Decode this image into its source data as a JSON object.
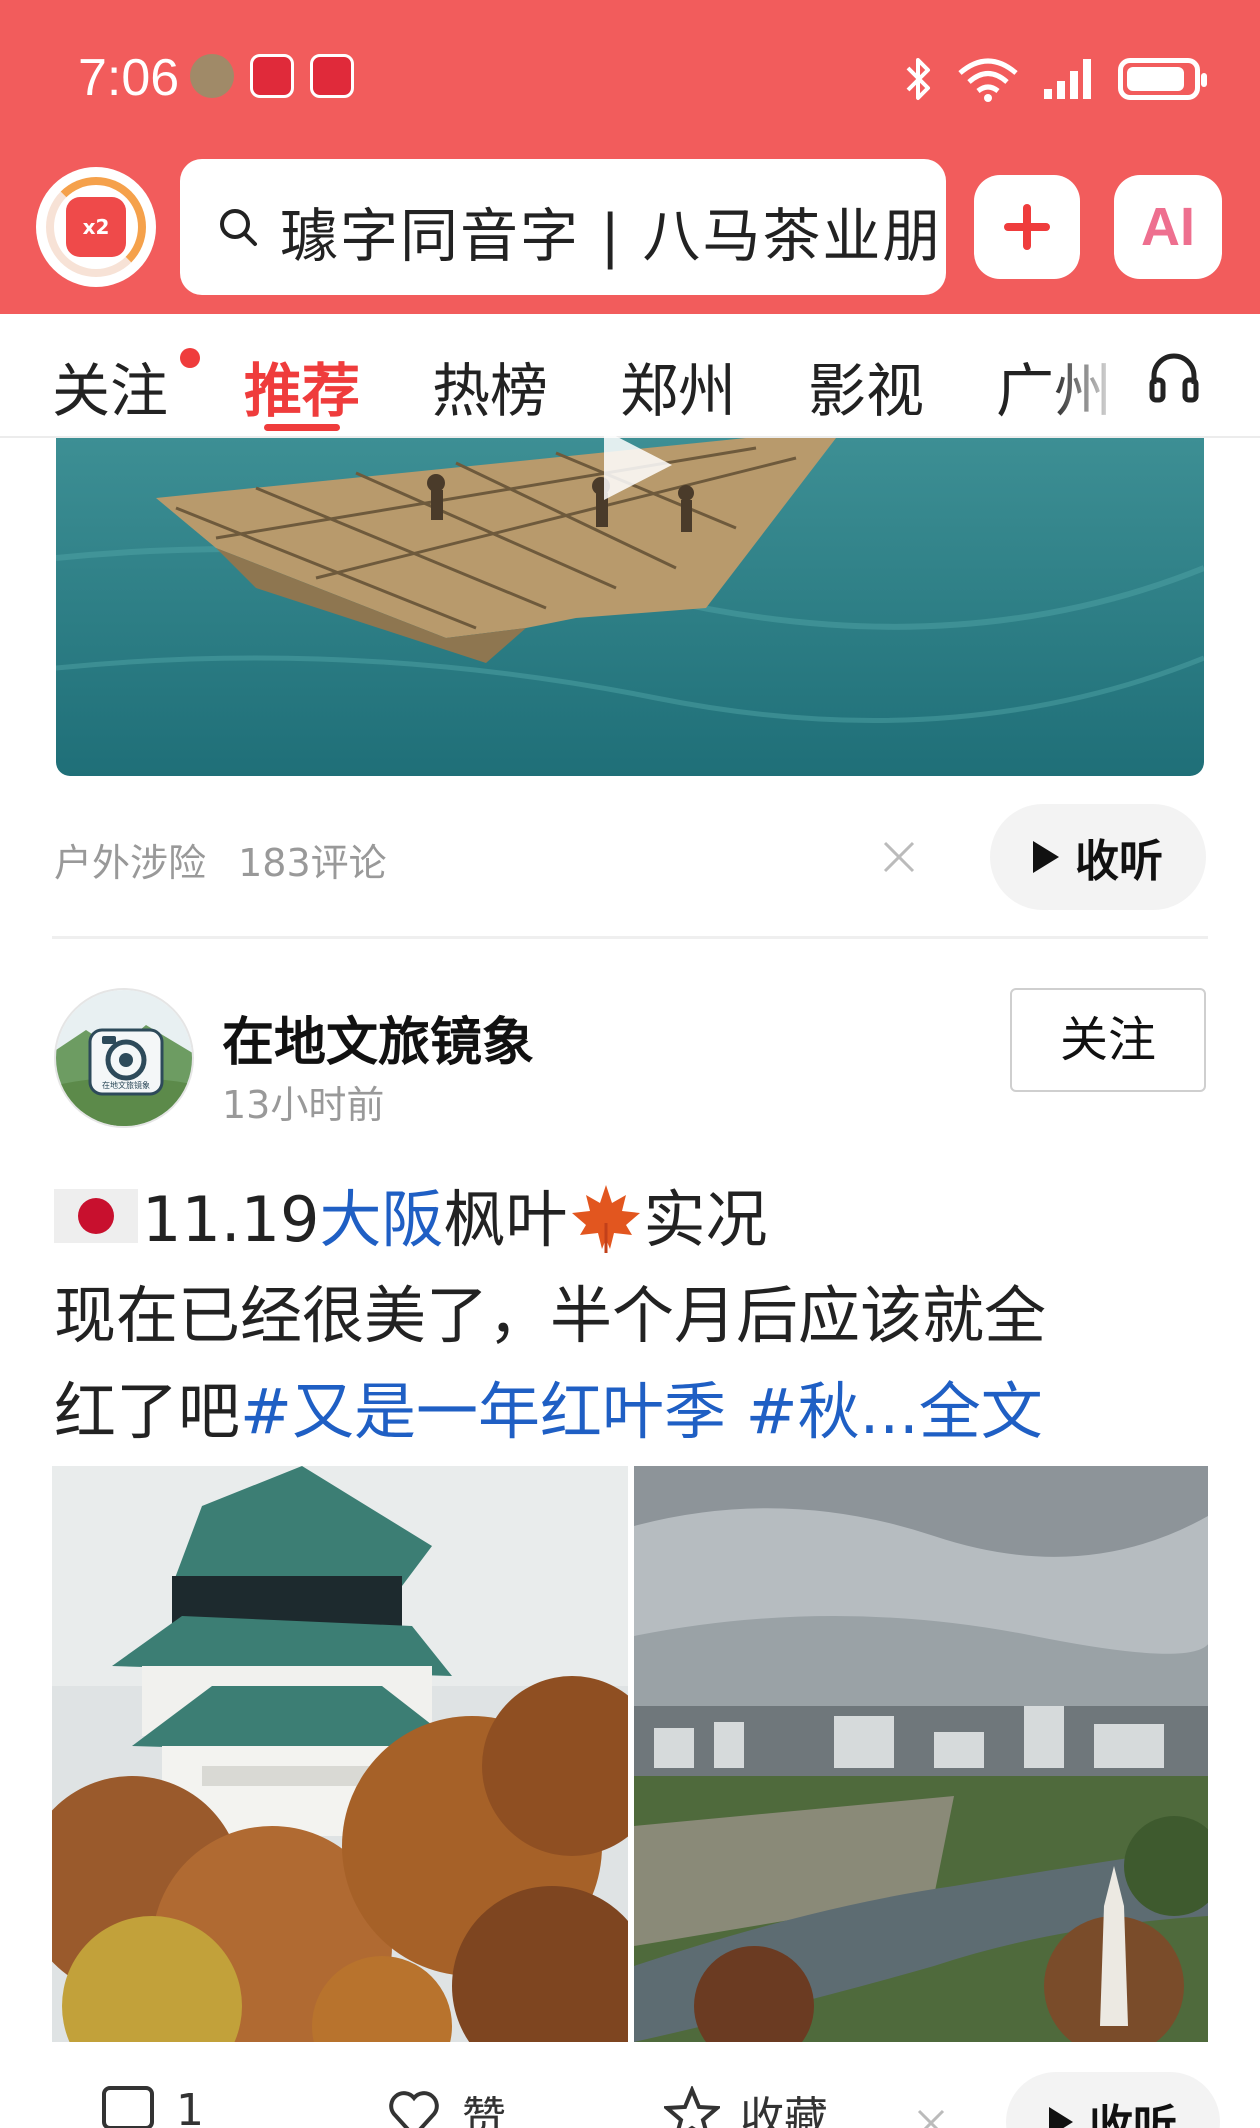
{
  "status_bar": {
    "time": "7:06",
    "battery_level": 0.9
  },
  "colors": {
    "brand": "#f25c5c",
    "accent": "#ef3c3c",
    "link": "#1f5fc4"
  },
  "top_bar": {
    "badge_label": "x2",
    "search_text": "璩字同音字 | 八马茶业朋",
    "ai_label": "AI"
  },
  "tabs": [
    {
      "label": "关注",
      "has_dot": true
    },
    {
      "label": "推荐",
      "active": true
    },
    {
      "label": "热榜"
    },
    {
      "label": "郑州"
    },
    {
      "label": "影视"
    },
    {
      "label": "广州"
    }
  ],
  "video_card": {
    "category": "户外涉险",
    "comments": "183评论",
    "listen_label": "收听"
  },
  "post": {
    "author": "在地文旅镜象",
    "time": "13小时前",
    "follow_label": "关注",
    "text_date": "11.19",
    "text_location_link": "大阪",
    "text_after_link": "枫叶",
    "text_after_leaf": "实况",
    "text_line2": "现在已经很美了，半个月后应该就全",
    "text_line3_plain": "红了吧",
    "text_line3_tags": "#又是一年红叶季 #秋...全文",
    "avatar_caption": "在地文旅镜象"
  },
  "actions": {
    "comment_count": "1",
    "like_label": "赞",
    "favorite_label": "收藏",
    "listen_label": "收听"
  }
}
